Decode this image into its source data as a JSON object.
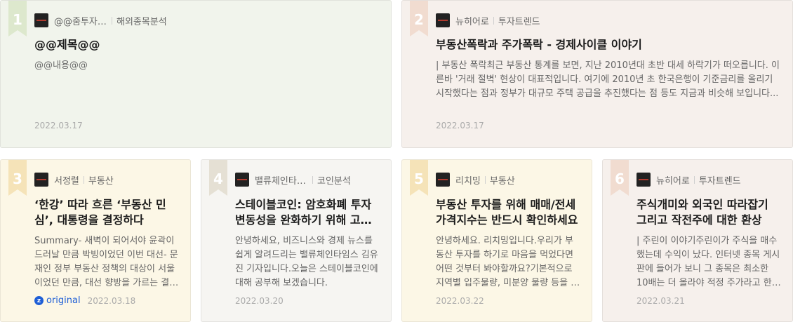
{
  "colors": {
    "card1_bg": "#f1f4ec",
    "card1_ribbon": "#dde8cd",
    "card2_bg": "#f6f0ec",
    "card2_ribbon": "#f1dcd0",
    "card3_bg": "#fcf7e6",
    "card3_ribbon": "#f5e3b8",
    "card4_bg": "#f6f5f2",
    "card4_ribbon": "#e5e0d4",
    "card5_bg": "#fcf7e6",
    "card5_ribbon": "#f5e3b8",
    "card6_bg": "#f6f0ec",
    "card6_ribbon": "#f1dcd0"
  },
  "cards": [
    {
      "rank": "1",
      "author": "@@줌투자@@",
      "category": "해외종목분석",
      "title": "@@제목@@",
      "summary": "@@내용@@",
      "date": "2022.03.17"
    },
    {
      "rank": "2",
      "author": "뉴히어로",
      "category": "투자트렌드",
      "title": "부동산폭락과 주가폭락 - 경제사이클 이야기",
      "summary": "| 부동산 폭락최근 부동산 통계를 보면, 지난 2010년대 초반 대세 하락기가 떠오릅니다. 이른바 '거래 절벽' 현상이 대표적입니다. 여기에 2010년 초 한국은행이 기준금리를 올리기 시작했다는 점과 정부가 대규모 주택 공급을 추진했다는 점 등도 지금과 비슷해 보입니다...",
      "date": "2022.03.17"
    },
    {
      "rank": "3",
      "author": "서정렬",
      "category": "부동산",
      "title": "‘한강’ 따라 흐른 ‘부동산 민심’, 대통령을 결정하다",
      "summary": "Summary- 새벽이 되어서야 윤곽이 드러날 만큼 박빙이었던 이번 대선- 문재인 정부 부동산 정책의 대상이 서울이었던 만큼, 대선 향방을 가르는 결정적 요인이 되다",
      "source_icon": "z",
      "source_label": "original",
      "date": "2022.03.18"
    },
    {
      "rank": "4",
      "author": "밸류체인타임스",
      "category": "코인분석",
      "title": "스테이블코인: 암호화폐 투자변동성을 완화하기 위해 고안된 코인",
      "summary": "안녕하세요, 비즈니스와 경제 뉴스를 쉽게 알려드리는 밸류체인타임스 김유진 기자입니다.오늘은 스테이블코인에 대해 공부해 보겠습니다.",
      "date": "2022.03.20"
    },
    {
      "rank": "5",
      "author": "리치밍",
      "category": "부동산",
      "title": "부동산 투자를 위해 매매/전세 가격지수는 반드시 확인하세요",
      "summary": "안녕하세요. 리치밍입니다.우리가 부동산 투자를 하기로 마음을 먹었다면 어떤 것부터 봐야할까요?기본적으로 지역별 입주물량, 미분양 물량 등을 확인합니다",
      "date": "2022.03.22"
    },
    {
      "rank": "6",
      "author": "뉴히어로",
      "category": "투자트렌드",
      "title": "주식개미와 외국인 따라잡기 그리고 작전주에 대한 환상",
      "summary": "| 주린이 이야기주린이가 주식을 매수했는데 수익이 났다. 인터넷 종목 게시판에 들어가 보니 그 종목은 최소한 10배는 더 올라야 적정 주가라고 한다.",
      "date": "2022.03.21"
    }
  ]
}
